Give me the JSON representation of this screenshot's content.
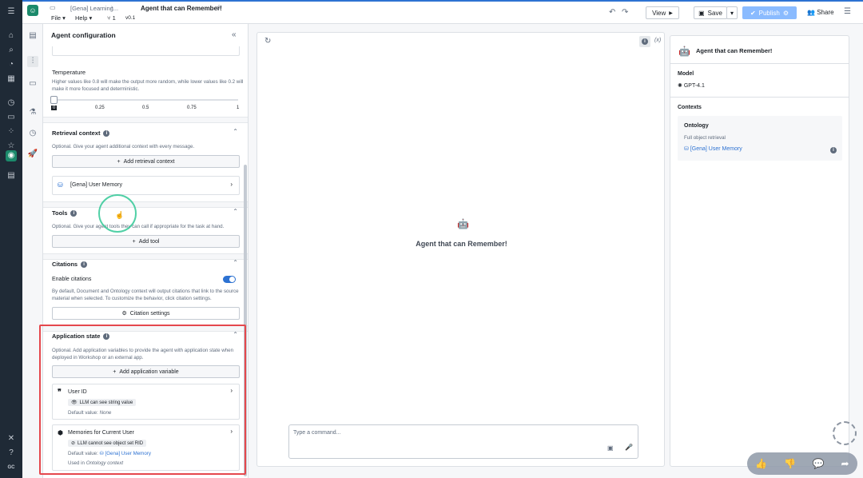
{
  "topbar": {
    "breadcrumb": "[Gena] Learning...",
    "title": "Agent that can Remember!",
    "menus": [
      "File",
      "Help"
    ],
    "branch_count": "1",
    "version": "v0.1",
    "view_label": "View",
    "save_label": "Save",
    "publish_label": "Publish",
    "share_label": "Share"
  },
  "config": {
    "heading": "Agent configuration",
    "temperature": {
      "title": "Temperature",
      "description": "Higher values like 0.8 will make the output more random, while lower values like 0.2 will make it more focused and deterministic.",
      "ticks": [
        "0",
        "0.25",
        "0.5",
        "0.75",
        "1"
      ],
      "value": 0
    },
    "retrieval": {
      "title": "Retrieval context",
      "description": "Optional. Give your agent additional context with every message.",
      "add_label": "Add retrieval context",
      "item_label": "[Gena] User Memory"
    },
    "tools": {
      "title": "Tools",
      "description": "Optional. Give your agent tools they can call if appropriate for the task at hand.",
      "add_label": "Add tool"
    },
    "citations": {
      "title": "Citations",
      "toggle_label": "Enable citations",
      "description": "By default, Document and Ontology context will output citations that link to the source material when selected. To customize the behavior, click citation settings.",
      "settings_label": "Citation settings"
    },
    "app_state": {
      "title": "Application state",
      "description": "Optional. Add application variables to provide the agent with application state when deployed in Workshop or an external app.",
      "add_label": "Add application variable",
      "variables": [
        {
          "name": "User ID",
          "tag": "LLM can see string value",
          "default_label": "Default value:",
          "default_value": "None"
        },
        {
          "name": "Memories for Current User",
          "tag": "LLM cannot see object set RID",
          "default_label": "Default value:",
          "default_value": "[Gena] User Memory",
          "used_in_label": "Used in",
          "used_in_value": "Ontology context"
        }
      ]
    }
  },
  "chat": {
    "agent_name": "Agent that can Remember!",
    "input_placeholder": "Type a command...",
    "var_label": "(x)"
  },
  "summary": {
    "agent_name": "Agent that can Remember!",
    "model_heading": "Model",
    "model_value": "GPT-4.1",
    "contexts_heading": "Contexts",
    "context_title": "Ontology",
    "context_subtitle": "Full object retrieval",
    "context_item": "[Gena] User Memory"
  },
  "rail_footer": "GC",
  "colors": {
    "accent": "#2d72d2",
    "highlight": "#e5484d",
    "rail": "#1f2a36"
  }
}
